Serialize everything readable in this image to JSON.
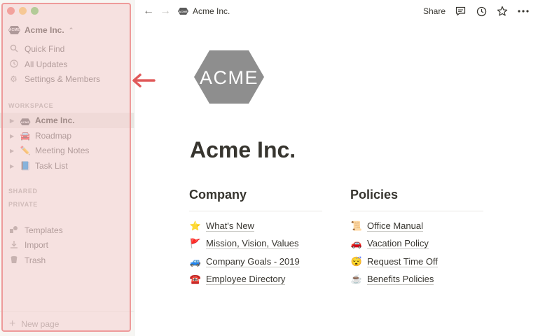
{
  "window": {
    "traffic_lights": [
      "close",
      "minimize",
      "zoom"
    ]
  },
  "sidebar": {
    "workspace_name": "Acme Inc.",
    "workspace_logo_text": "ACME",
    "top_links": [
      {
        "label": "Quick Find",
        "icon": "search-icon"
      },
      {
        "label": "All Updates",
        "icon": "clock-icon"
      },
      {
        "label": "Settings & Members",
        "icon": "gear-icon"
      }
    ],
    "workspace_label": "WORKSPACE",
    "pages": [
      {
        "label": "Acme Inc.",
        "icon": "acme-logo-icon",
        "active": true
      },
      {
        "label": "Roadmap",
        "icon": "🚘"
      },
      {
        "label": "Meeting Notes",
        "icon": "✏️"
      },
      {
        "label": "Task List",
        "icon": "📘"
      }
    ],
    "shared_label": "SHARED",
    "private_label": "PRIVATE",
    "bottom_links": [
      {
        "label": "Templates",
        "icon": "templates-icon"
      },
      {
        "label": "Import",
        "icon": "download-icon"
      },
      {
        "label": "Trash",
        "icon": "trash-icon"
      }
    ],
    "new_page_label": "New page",
    "new_page_icon": "+"
  },
  "topbar": {
    "breadcrumb": "Acme Inc.",
    "share_label": "Share"
  },
  "main": {
    "logo_text": "ACME",
    "title": "Acme Inc.",
    "columns": [
      {
        "heading": "Company",
        "links": [
          {
            "emoji": "⭐",
            "label": "What's New"
          },
          {
            "emoji": "🚩",
            "label": "Mission, Vision, Values"
          },
          {
            "emoji": "🚙",
            "label": "Company Goals - 2019"
          },
          {
            "emoji": "☎️",
            "label": "Employee Directory"
          }
        ]
      },
      {
        "heading": "Policies",
        "links": [
          {
            "emoji": "📜",
            "label": "Office Manual"
          },
          {
            "emoji": "🚗",
            "label": "Vacation Policy"
          },
          {
            "emoji": "😴",
            "label": "Request Time Off"
          },
          {
            "emoji": "☕",
            "label": "Benefits Policies"
          }
        ]
      }
    ]
  },
  "colors": {
    "sidebar_bg": "#f7f6f3",
    "highlight_fill": "#f6d0d0",
    "highlight_border": "#ee9a9a",
    "arrow": "#e05a5a",
    "text": "#37352f"
  }
}
